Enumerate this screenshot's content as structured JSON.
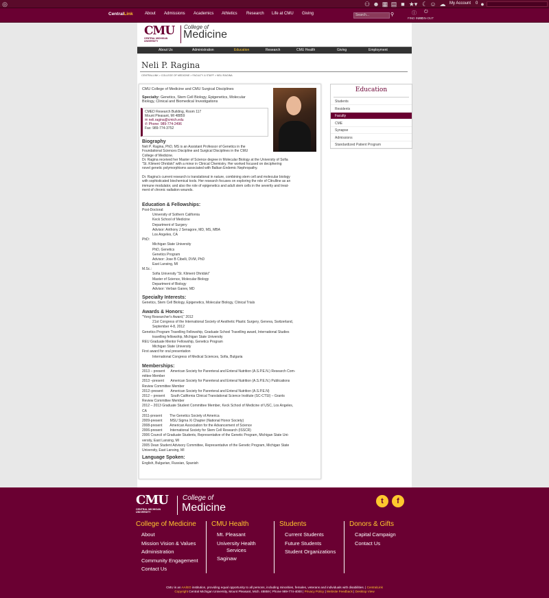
{
  "system_bar": {
    "my_account": "My Account",
    "notif_count": "0"
  },
  "top_nav": {
    "brand_a": "Central",
    "brand_b": "Link",
    "items": [
      "About",
      "Admissions",
      "Academics",
      "Athletics",
      "Research",
      "Life at CMU",
      "Giving"
    ],
    "search_placeholder": "Search...",
    "find_info": "FIND INFO",
    "sign_out": "SIGN-OUT"
  },
  "logo": {
    "cmu": "CMU",
    "university": "CENTRAL MICHIGAN UNIVERSITY",
    "college_of": "College of",
    "medicine": "Medicine"
  },
  "secondary_nav": [
    "About Us",
    "Administration",
    "Education",
    "Research",
    "CMU Health",
    "Giving",
    "Employment"
  ],
  "page": {
    "title": "Neli P. Ragina",
    "breadcrumb": "CENTRALLINK > COLLEGE OF MEDICINE > FACULTY & STAFF > NELI RAGINA"
  },
  "profile": {
    "affiliation": "CMU College of Medicine and CMU Surgical Disciplines",
    "specialty_label": "Specialty:",
    "specialty_lines": [
      "Genetics, Stem Cell Biology, Epigenetics, Molecular",
      "Biology, Clinical and Biomedical Investigations"
    ],
    "contact": {
      "address1": "CMED Research Building, Room 117",
      "address2": "Mount Pleasant, MI 48859",
      "email": "neli.ragina@cmich.edu",
      "phone": "Phone: 989-774-2496",
      "fax": "Fax: 989-774-3752"
    },
    "biography_title": "Biography",
    "biography_lines": [
      "Neli P. Ragina, PhD, MS is an Assistant Professor of Genetics in the",
      "Foundational Sciences Discipline and Surgical Disciplines in the CMU",
      "College of Medicine.",
      "Dr. Ragina received her Master of Science degree in Molecular Biology at the University of Sofia",
      "\"St. Kliment Ohridski\" with a minor in Clinical Chemistry. Her worked focused on deciphering",
      "novel genetic polymorphisms associated with Balkan Endemic Nephropathy.",
      "",
      "Dr. Ragina's current research is translational in nature, combining stem cell and molecular biology",
      "with sophisticated biochemical tools. Her research focuses on exploring the role of Citrulline as an",
      "immune modulator, and also the role of epigenetics and adult stem cells in the severity and treat-",
      "ment of chronic radiation wounds."
    ],
    "education_title": "Education & Fellowships:",
    "education_lines": [
      {
        "t": "Post-Doctoral:",
        "i": 0
      },
      {
        "t": "University of Sothern California",
        "i": 1
      },
      {
        "t": "Keck School of Medicine",
        "i": 1
      },
      {
        "t": "Department of Surgery",
        "i": 1
      },
      {
        "t": "Advisor: Anthony J Senagore, MD, MS, MBA",
        "i": 1
      },
      {
        "t": "Los Angeles, CA",
        "i": 1
      },
      {
        "t": "PhD:",
        "i": 0
      },
      {
        "t": "Michigan State University",
        "i": 1
      },
      {
        "t": "PhD, Genetics",
        "i": 1
      },
      {
        "t": "Genetics Program",
        "i": 1
      },
      {
        "t": "Advisor: Jose B Cibelli, DVM, PhD",
        "i": 1
      },
      {
        "t": "East Lansing, MI",
        "i": 1
      },
      {
        "t": "M.Sc.:",
        "i": 0
      },
      {
        "t": "Sofia University \"St. Kliment Ohridski\"",
        "i": 1
      },
      {
        "t": "Master of Science, Molecular Biology",
        "i": 1
      },
      {
        "t": "Department of Biology",
        "i": 1
      },
      {
        "t": "Advisor: Verban Ganev, MD",
        "i": 1
      }
    ],
    "specialty_interests_title": "Specialty Interests:",
    "specialty_interests": "Genetics, Stem Cell Biology, Epigenetics, Molecular Biology, Clinical Trials",
    "awards_title": "Awards & Honors:",
    "awards_lines": [
      {
        "t": "\"Yong Researcher's Award,\" 2012",
        "i": 0
      },
      {
        "t": "21st Congress of the International Society of Aesthetic Plastic Surgery, Geneva, Switzerland,",
        "i": 1
      },
      {
        "t": "September 4-8, 2012",
        "i": 1
      },
      {
        "t": "Genetics Program Travelling Fellowship, Graduate School Travelling award, International Studies",
        "i": 0
      },
      {
        "t": "travelling fellowship, Michigan State University",
        "i": 1
      },
      {
        "t": "REU Graduate Mentor Fellowship, Genetics Program",
        "i": 0
      },
      {
        "t": "Michigan State University",
        "i": 1
      },
      {
        "t": "First award for oral presentation",
        "i": 0
      },
      {
        "t": "International Congress of Medical Sciences, Sofia, Bulgaria",
        "i": 1
      }
    ],
    "memberships_title": "Memberships:",
    "memberships_lines": [
      "2013 – present      American Society for Parenteral and Enteral Nutrition (A.S.P.E.N.) Research Com-",
      "mittee Member",
      "2013 –present       American Society for Parenteral and Enteral Nutrition (A.S.P.E.N.) Publications",
      "Review Committee Member",
      "2012–present        American Society for Parenteral and Enteral Nutrition (A.S.P.E.N)",
      "2012 – present      South California Clinical Translational Science Institute (SC-CTSI) – Grants",
      "Review Committee Member",
      "2012 – 2013 Graduate Student Committee Member, Keck School of Medicine of USC, Los Angeles,",
      "CA",
      "2011-present        The Genetics Society of America",
      "2009-present        MSU Sigma Xi Chapter (National Honor Society)",
      "2008-present        American Association for the Advancement of Science",
      "2006-present        International Society for Stem Cell Research (ISSCR)",
      "2006 Council of Graduate Students, Representative of the Genetic Program, Michigan State Uni-",
      "versity, East Lansing, MI",
      "2005 Dean Student Advisory Committee, Representative of the Genetic Program, Michigan State",
      "University, East Lansing, MI"
    ],
    "language_title": "Language Spoken:",
    "languages": "English, Bulgarian, Russian, Spanish"
  },
  "sidebar": {
    "title": "Education",
    "items": [
      "Students",
      "Residents",
      "Faculty",
      "CME",
      "Synapse",
      "Admissions",
      "Standardized Patient Program"
    ],
    "active_index": 2
  },
  "footer": {
    "cols": [
      {
        "title": "College of Medicine",
        "links": [
          "About",
          "Mission Vision & Values",
          "Administration",
          "Community Engagement",
          "Contact Us"
        ]
      },
      {
        "title": "CMU Health",
        "links": [
          "Mt. Pleasant",
          "University Health\nServices",
          "Saginaw"
        ]
      },
      {
        "title": "Students",
        "links": [
          "Current Students",
          "Future Students",
          "Student Organizations"
        ]
      },
      {
        "title": "Donors & Gifts",
        "links": [
          "Capital Campaign",
          "Contact Us"
        ]
      }
    ],
    "twitter": "t",
    "facebook": "f",
    "legal1_a": "CMU is an ",
    "legal1_aa": "AA/EO",
    "legal1_b": " institution, providing equal opportunity to all persons, including minorities, females, veterans and individuals with disabilities. | ",
    "legal1_c": "CentralLink",
    "legal2_a": "Copyright",
    "legal2_b": " Central Michigan University, Mount Pleasant, Mich. 48859 | Phone 989-774-4000 | ",
    "legal2_c": "Privacy Policy",
    "legal2_d": " | ",
    "legal2_e": "Website Feedback",
    "legal2_f": " | ",
    "legal2_g": "Desktop View"
  },
  "colors": {
    "maroon": "#6a0032",
    "gold": "#ffc82e"
  }
}
